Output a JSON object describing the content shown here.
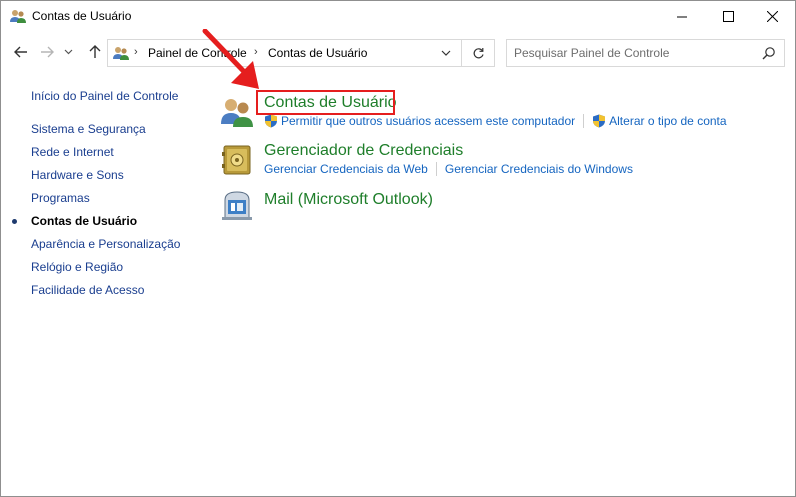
{
  "window": {
    "title": "Contas de Usuário"
  },
  "navigation": {
    "breadcrumb": [
      "Painel de Controle",
      "Contas de Usuário"
    ],
    "search_placeholder": "Pesquisar Painel de Controle"
  },
  "sidebar": {
    "home": "Início do Painel de Controle",
    "items": [
      {
        "label": "Sistema e Segurança",
        "active": false
      },
      {
        "label": "Rede e Internet",
        "active": false
      },
      {
        "label": "Hardware e Sons",
        "active": false
      },
      {
        "label": "Programas",
        "active": false
      },
      {
        "label": "Contas de Usuário",
        "active": true
      },
      {
        "label": "Aparência e Personalização",
        "active": false
      },
      {
        "label": "Relógio e Região",
        "active": false
      },
      {
        "label": "Facilidade de Acesso",
        "active": false
      }
    ]
  },
  "categories": [
    {
      "title": "Contas de Usuário",
      "icon": "user-accounts-icon",
      "links": [
        "Permitir que outros usuários acessem este computador",
        "Alterar o tipo de conta"
      ]
    },
    {
      "title": "Gerenciador de Credenciais",
      "icon": "credential-manager-icon",
      "links": [
        "Gerenciar Credenciais da Web",
        "Gerenciar Credenciais do Windows"
      ]
    },
    {
      "title": "Mail (Microsoft Outlook)",
      "icon": "mail-icon",
      "links": []
    }
  ],
  "colors": {
    "category_title": "#1e7e2a",
    "link": "#1565c0",
    "sidebar_link": "#1a3e8f",
    "annotation": "#e51e1e"
  }
}
